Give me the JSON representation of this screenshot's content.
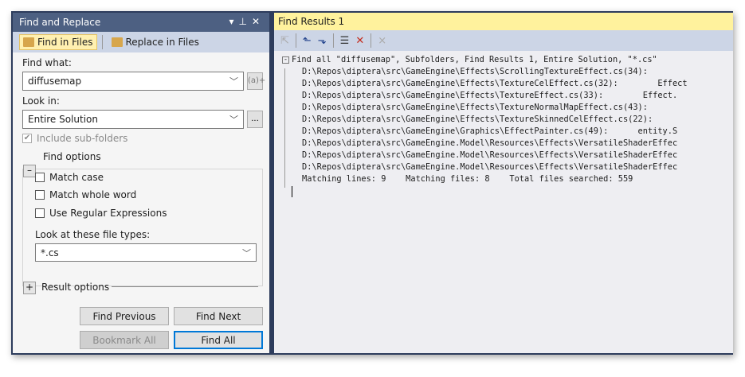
{
  "find_panel": {
    "title": "Find and Replace",
    "tabs": [
      {
        "label": "Find in Files",
        "active": true
      },
      {
        "label": "Replace in Files",
        "active": false
      }
    ],
    "find_what_label": "Find what:",
    "find_what_value": "diffusemap",
    "regex_builder_label": "(a)+",
    "look_in_label": "Look in:",
    "look_in_value": "Entire Solution",
    "browse_label": "...",
    "include_subfolders": {
      "label": "Include sub-folders",
      "checked": true,
      "disabled": true
    },
    "find_options_label": "Find options",
    "options": [
      {
        "label": "Match case",
        "checked": false
      },
      {
        "label": "Match whole word",
        "checked": false
      },
      {
        "label": "Use Regular Expressions",
        "checked": false
      }
    ],
    "file_types_label": "Look at these file types:",
    "file_types_value": "*.cs",
    "result_options_label": "Result options",
    "buttons": {
      "find_previous": "Find Previous",
      "find_next": "Find Next",
      "bookmark_all": "Bookmark All",
      "find_all": "Find All"
    }
  },
  "results_panel": {
    "title": "Find Results 1",
    "header": "Find all \"diffusemap\", Subfolders, Find Results 1, Entire Solution, \"*.cs\"",
    "lines": [
      "D:\\Repos\\diptera\\src\\GameEngine\\Effects\\ScrollingTextureEffect.cs(34):",
      "D:\\Repos\\diptera\\src\\GameEngine\\Effects\\TextureCelEffect.cs(32):        Effect",
      "D:\\Repos\\diptera\\src\\GameEngine\\Effects\\TextureEffect.cs(33):        Effect.",
      "D:\\Repos\\diptera\\src\\GameEngine\\Effects\\TextureNormalMapEffect.cs(43):",
      "D:\\Repos\\diptera\\src\\GameEngine\\Effects\\TextureSkinnedCelEffect.cs(22):",
      "D:\\Repos\\diptera\\src\\GameEngine\\Graphics\\EffectPainter.cs(49):      entity.S",
      "D:\\Repos\\diptera\\src\\GameEngine.Model\\Resources\\Effects\\VersatileShaderEffec",
      "D:\\Repos\\diptera\\src\\GameEngine.Model\\Resources\\Effects\\VersatileShaderEffec",
      "D:\\Repos\\diptera\\src\\GameEngine.Model\\Resources\\Effects\\VersatileShaderEffec"
    ],
    "summary": "Matching lines: 9    Matching files: 8    Total files searched: 559"
  }
}
